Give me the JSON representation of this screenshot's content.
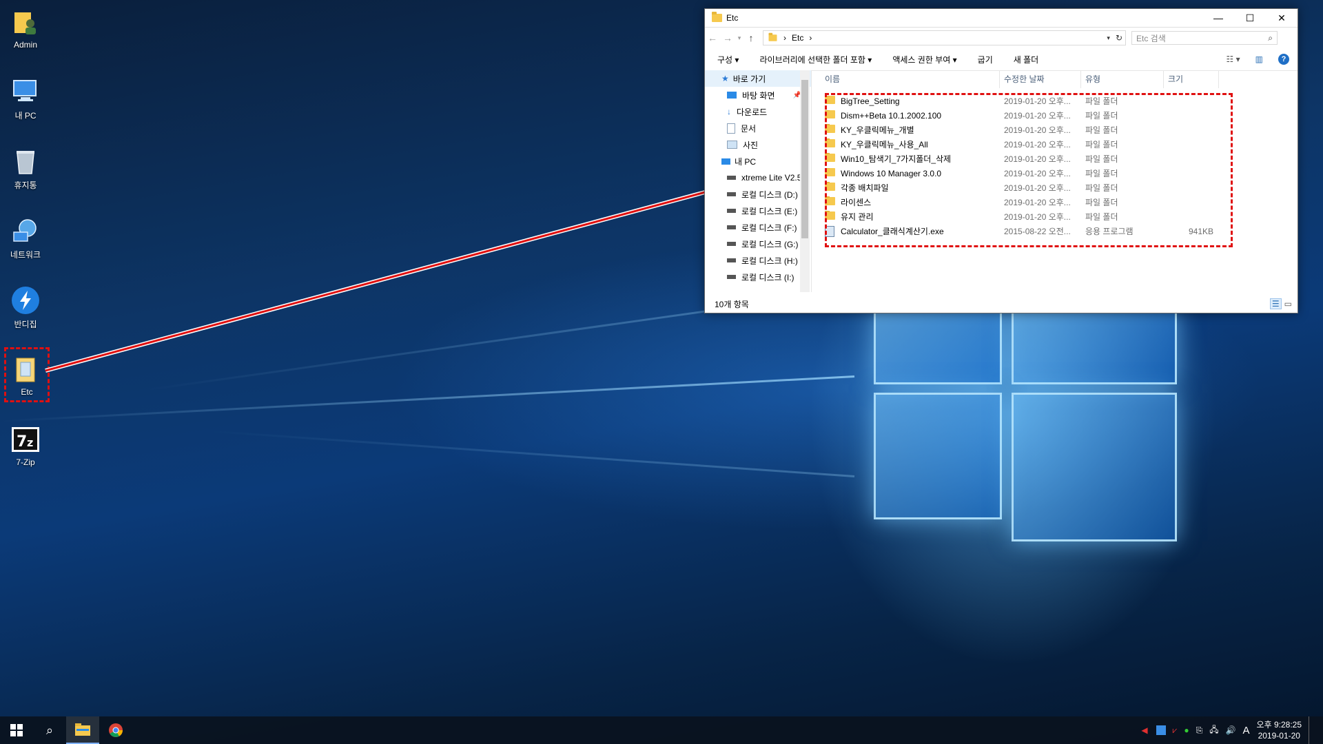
{
  "desktop": {
    "icons": [
      {
        "label": "Admin",
        "icon": "user-folder-icon"
      },
      {
        "label": "내 PC",
        "icon": "computer-icon"
      },
      {
        "label": "휴지통",
        "icon": "recycle-bin-icon"
      },
      {
        "label": "네트워크",
        "icon": "network-icon"
      },
      {
        "label": "반디집",
        "icon": "bandizip-icon"
      },
      {
        "label": "Etc",
        "icon": "folder-icon",
        "selected": true
      },
      {
        "label": "7-Zip",
        "icon": "7zip-icon"
      }
    ]
  },
  "explorer": {
    "title": "Etc",
    "window_controls": {
      "minimize": "—",
      "maximize": "☐",
      "close": "✕"
    },
    "address": {
      "path_separator": "›",
      "segment": "Etc",
      "trailing": "›"
    },
    "search_placeholder": "Etc 검색",
    "commands": [
      "구성 ▾",
      "라이브러리에 선택한 폴더 포함 ▾",
      "액세스 권한 부여 ▾",
      "굽기",
      "새 폴더"
    ],
    "nav": {
      "quick_access": "바로 가기",
      "items": [
        "바탕 화면",
        "다운로드",
        "문서",
        "사진"
      ],
      "this_pc": "내 PC",
      "drives": [
        "xtreme Lite V2.5",
        "로컬 디스크 (D:)",
        "로컬 디스크 (E:)",
        "로컬 디스크 (F:)",
        "로컬 디스크 (G:)",
        "로컬 디스크 (H:)",
        "로컬 디스크 (I:)"
      ]
    },
    "columns": {
      "name": "이름",
      "date": "수정한 날짜",
      "type": "유형",
      "size": "크기"
    },
    "files": [
      {
        "name": "BigTree_Setting",
        "date": "2019-01-20 오후...",
        "type": "파일 폴더",
        "size": "",
        "kind": "folder"
      },
      {
        "name": "Dism++Beta 10.1.2002.100",
        "date": "2019-01-20 오후...",
        "type": "파일 폴더",
        "size": "",
        "kind": "folder"
      },
      {
        "name": "KY_우클릭메뉴_개별",
        "date": "2019-01-20 오후...",
        "type": "파일 폴더",
        "size": "",
        "kind": "folder"
      },
      {
        "name": "KY_우클릭메뉴_사용_All",
        "date": "2019-01-20 오후...",
        "type": "파일 폴더",
        "size": "",
        "kind": "folder"
      },
      {
        "name": "Win10_탐색기_7가지폴더_삭제",
        "date": "2019-01-20 오후...",
        "type": "파일 폴더",
        "size": "",
        "kind": "folder"
      },
      {
        "name": "Windows 10 Manager 3.0.0",
        "date": "2019-01-20 오후...",
        "type": "파일 폴더",
        "size": "",
        "kind": "folder"
      },
      {
        "name": "각종 배치파일",
        "date": "2019-01-20 오후...",
        "type": "파일 폴더",
        "size": "",
        "kind": "folder"
      },
      {
        "name": "라이센스",
        "date": "2019-01-20 오후...",
        "type": "파일 폴더",
        "size": "",
        "kind": "folder"
      },
      {
        "name": "유지 관리",
        "date": "2019-01-20 오후...",
        "type": "파일 폴더",
        "size": "",
        "kind": "folder"
      },
      {
        "name": "Calculator_클래식계산기.exe",
        "date": "2015-08-22 오전...",
        "type": "응용 프로그램",
        "size": "941KB",
        "kind": "exe"
      }
    ],
    "status": "10개 항목"
  },
  "taskbar": {
    "clock_time": "오후 9:28:25",
    "clock_date": "2019-01-20",
    "ime": "A"
  },
  "colors": {
    "highlight": "#e01010",
    "accent": "#0078d7"
  }
}
